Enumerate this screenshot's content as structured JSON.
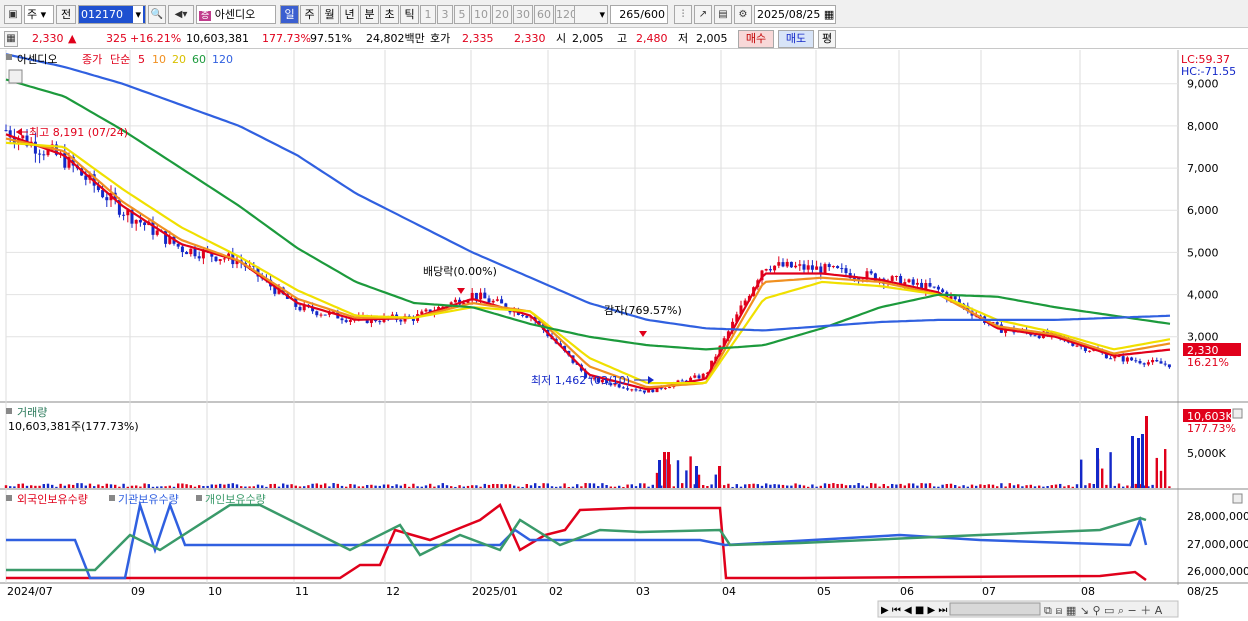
{
  "toolbar": {
    "type_label": "주",
    "prev_label": "전",
    "code": "012170",
    "stock_name": "아센디오",
    "periods": [
      "일",
      "주",
      "월",
      "년",
      "분",
      "초",
      "틱"
    ],
    "periods_active": "일",
    "intervals": [
      "1",
      "3",
      "5",
      "10",
      "20",
      "30",
      "60",
      "120"
    ],
    "count": "265",
    "total": "/600",
    "date": "2025/08/25"
  },
  "info": {
    "price": "2,330",
    "arrow": "▲",
    "change": "325",
    "change_pct": "+16.21%",
    "volume": "10,603,381",
    "vol_ratio": "177.73%",
    "strength": "97.51%",
    "amount": "24,802백만",
    "quote_label": "호가",
    "ask": "2,335",
    "bid": "2,330",
    "open_label": "시",
    "open": "2,005",
    "high_label": "고",
    "high": "2,480",
    "low_label": "저",
    "low": "2,005",
    "buy_label": "매수",
    "sell_label": "매도",
    "eval_label": "평"
  },
  "price_legend": {
    "name": "아센디오",
    "close": "종가",
    "simple": "단순",
    "ma5": "5",
    "ma10": "10",
    "ma20": "20",
    "ma60": "60",
    "ma120": "120"
  },
  "price_panel": {
    "lc": "LC:59.37",
    "hc": "HC:-71.55",
    "current_label": "2,330",
    "current_pct": "16.21%",
    "high_annotation": "최고 8,191 (07/24)",
    "low_annotation": "최저 1,462 (03/10)",
    "dividend_annotation": "배당락(0.00%)",
    "reduction_annotation": "감자(769.57%)"
  },
  "y_ticks": [
    "9,000",
    "8,000",
    "7,000",
    "6,000",
    "5,000",
    "4,000",
    "3,000"
  ],
  "volume_panel": {
    "title": "거래량",
    "value": "10,603,381주(177.73%)",
    "tick": "5,000K",
    "current_label": "10,603K",
    "current_pct": "177.73%"
  },
  "holding_panel": {
    "foreign": "외국인보유수량",
    "inst": "기관보유수량",
    "indiv": "개인보유수량",
    "ticks": [
      "28,000,000",
      "27,000,000",
      "26,000,000"
    ]
  },
  "x_labels": [
    "2024/07",
    "09",
    "10",
    "11",
    "12",
    "2025/01",
    "02",
    "03",
    "04",
    "05",
    "06",
    "07",
    "08",
    "08/25"
  ],
  "colors": {
    "up": "#e0001b",
    "down": "#1428c8",
    "ma5": "#e0001b",
    "ma10": "#f09020",
    "ma20": "#f0e000",
    "ma60": "#1c9a3c",
    "ma120": "#3060e0",
    "foreign": "#e0001b",
    "inst": "#3060e0",
    "indiv": "#3a9a6a"
  },
  "chart_data": {
    "type": "line",
    "x": [
      "2024/07",
      "09",
      "10",
      "11",
      "12",
      "2025/01",
      "02",
      "03",
      "04",
      "05",
      "06",
      "07",
      "08"
    ],
    "ylim": [
      1500,
      9800
    ],
    "series": [
      {
        "name": "종가",
        "values": [
          7900,
          7200,
          6000,
          5100,
          4800,
          3700,
          3400,
          3450,
          4000,
          3500,
          2000,
          1700,
          2100,
          4700,
          4600,
          4400,
          4100,
          3200,
          3000,
          2500,
          2330
        ]
      },
      {
        "name": "5",
        "values": [
          7800,
          7300,
          6100,
          5200,
          4800,
          3800,
          3400,
          3450,
          3900,
          3500,
          2100,
          1750,
          2000,
          4500,
          4500,
          4350,
          4050,
          3200,
          3000,
          2550,
          2700
        ]
      },
      {
        "name": "10",
        "values": [
          7700,
          7400,
          6200,
          5300,
          4800,
          3900,
          3450,
          3450,
          3800,
          3600,
          2300,
          1800,
          1900,
          4300,
          4400,
          4300,
          4000,
          3250,
          3050,
          2600,
          2850
        ]
      },
      {
        "name": "20",
        "values": [
          7600,
          7500,
          6500,
          5600,
          4900,
          4100,
          3500,
          3450,
          3700,
          3600,
          2500,
          1900,
          1900,
          3900,
          4300,
          4200,
          4000,
          3400,
          3100,
          2700,
          2950
        ]
      },
      {
        "name": "60",
        "values": [
          9100,
          8700,
          7900,
          7000,
          6100,
          5100,
          4300,
          3800,
          3700,
          3300,
          3000,
          2800,
          2700,
          2800,
          3200,
          3700,
          4000,
          3950,
          3700,
          3500,
          3300
        ]
      },
      {
        "name": "120",
        "values": [
          9700,
          9400,
          9000,
          8500,
          8000,
          7300,
          6400,
          5700,
          5000,
          4400,
          3800,
          3400,
          3200,
          3150,
          3250,
          3350,
          3400,
          3400,
          3400,
          3450,
          3500
        ]
      }
    ]
  }
}
